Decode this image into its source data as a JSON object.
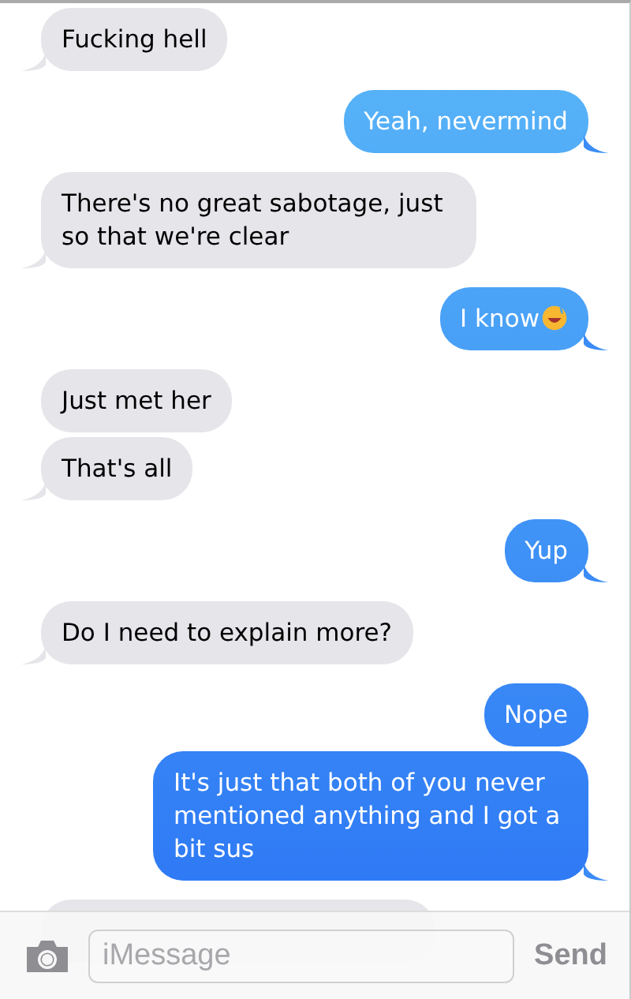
{
  "messages": [
    {
      "kind": "received",
      "text": "Fucking hell",
      "tail": true
    },
    {
      "kind": "sent",
      "text": "Yeah, nevermind",
      "tail": true
    },
    {
      "kind": "received",
      "text": "There's no great sabotage, just so that we're clear",
      "tail": true
    },
    {
      "kind": "sent",
      "text": "I know",
      "emoji": true,
      "tail": true
    },
    {
      "kind": "received",
      "text": "Just met her",
      "tail": false
    },
    {
      "kind": "received",
      "text": "That's all",
      "tail": true
    },
    {
      "kind": "sent",
      "text": "Yup",
      "tail": true
    },
    {
      "kind": "received",
      "text": "Do I need to explain more?",
      "tail": true
    },
    {
      "kind": "sent",
      "text": "Nope",
      "tail": false
    },
    {
      "kind": "sent",
      "text": "It's just that both of you never mentioned anything and I got a bit sus",
      "tail": true
    },
    {
      "kind": "received",
      "tail": false
    }
  ],
  "input_bar": {
    "placeholder": "iMessage",
    "send": "Send"
  }
}
